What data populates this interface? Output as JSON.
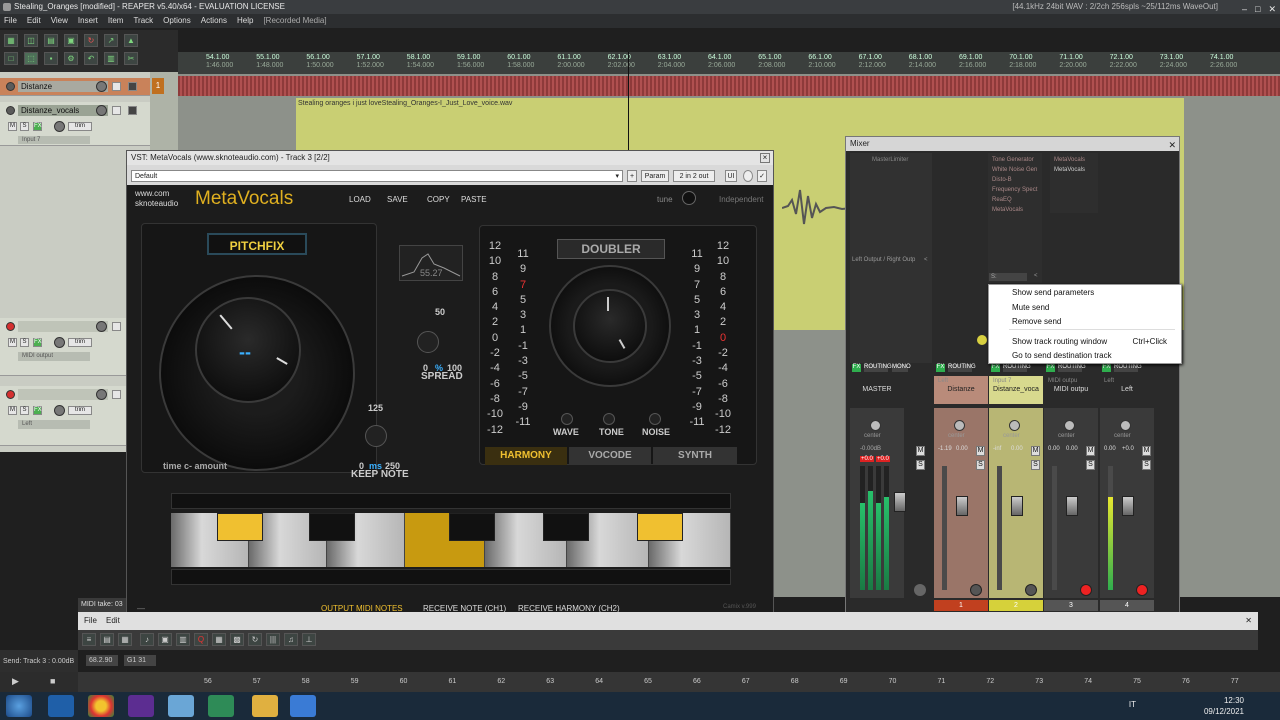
{
  "window": {
    "title": "Stealing_Oranges [modified] - REAPER v5.40/x64 - EVALUATION LICENSE",
    "status": "[44.1kHz 24bit WAV : 2/2ch 256spls ~25/112ms WaveOut]"
  },
  "menu": [
    "File",
    "Edit",
    "View",
    "Insert",
    "Item",
    "Track",
    "Options",
    "Actions",
    "Help"
  ],
  "menu_recorded": "[Recorded Media]",
  "ruler": [
    {
      "bar": "54.1.00",
      "time": "1:46.000"
    },
    {
      "bar": "55.1.00",
      "time": "1:48.000"
    },
    {
      "bar": "56.1.00",
      "time": "1:50.000"
    },
    {
      "bar": "57.1.00",
      "time": "1:52.000"
    },
    {
      "bar": "58.1.00",
      "time": "1:54.000"
    },
    {
      "bar": "59.1.00",
      "time": "1:56.000"
    },
    {
      "bar": "60.1.00",
      "time": "1:58.000"
    },
    {
      "bar": "61.1.00",
      "time": "2:00.000"
    },
    {
      "bar": "62.1.00",
      "time": "2:02.000"
    },
    {
      "bar": "63.1.00",
      "time": "2:04.000"
    },
    {
      "bar": "64.1.00",
      "time": "2:06.000"
    },
    {
      "bar": "65.1.00",
      "time": "2:08.000"
    },
    {
      "bar": "66.1.00",
      "time": "2:10.000"
    },
    {
      "bar": "67.1.00",
      "time": "2:12.000"
    },
    {
      "bar": "68.1.00",
      "time": "2:14.000"
    },
    {
      "bar": "69.1.00",
      "time": "2:16.000"
    },
    {
      "bar": "70.1.00",
      "time": "2:18.000"
    },
    {
      "bar": "71.1.00",
      "time": "2:20.000"
    },
    {
      "bar": "72.1.00",
      "time": "2:22.000"
    },
    {
      "bar": "73.1.00",
      "time": "2:24.000"
    },
    {
      "bar": "74.1.00",
      "time": "2:26.000"
    }
  ],
  "tracks": {
    "t1": {
      "name": "Distanze",
      "number": "1"
    },
    "t2": {
      "name": "Distanze_vocals",
      "input": "Input 7"
    },
    "t3": {
      "input": "MIDI output"
    },
    "t4": {
      "input": "Left"
    }
  },
  "track_buttons": {
    "m": "M",
    "s": "S",
    "fx": "FX",
    "trim": "trim",
    "route": "ROUTE",
    "out": "OUT"
  },
  "item": {
    "label": "Stealing oranges i just loveStealing_Oranges-I_Just_Love_voice.wav"
  },
  "vst": {
    "title": "VST: MetaVocals (www.sknoteaudio.com) - Track 3 [2/2]",
    "preset": "Default",
    "plus": "+",
    "param": "Param",
    "io": "2 in 2 out",
    "ui": "UI",
    "close": "×",
    "plugin": {
      "brand_line1": "www.com",
      "brand_line2": "sknoteaudio",
      "name": "MetaVocals",
      "load": "LOAD",
      "save": "SAVE",
      "copy": "COPY",
      "paste": "PASTE",
      "tune": "tune",
      "independent": "Independent",
      "pitchfix": "PITCHFIX",
      "pitch_display": "--",
      "time_label": "time c- amount",
      "spread_value": "50",
      "spread_min": "0",
      "spread_unit": "%",
      "spread_max": "100",
      "spread": "SPREAD",
      "graph_value": "55.27",
      "keep_value": "125",
      "keep_min": "0",
      "keep_unit": "ms",
      "keep_max": "250",
      "keep_note": "KEEP NOTE",
      "doubler": "DOUBLER",
      "wave": "WAVE",
      "tone": "TONE",
      "noise": "NOISE",
      "harmony": "HARMONY",
      "vocode": "VOCODE",
      "synth": "SYNTH",
      "scale_left": [
        "12",
        "10",
        "8",
        "6",
        "4",
        "2",
        "0",
        "-2",
        "-4",
        "-6",
        "-8",
        "-10",
        "-12"
      ],
      "scale_left_odd": [
        "11",
        "9",
        "7",
        "5",
        "3",
        "1",
        "-1",
        "-3",
        "-5",
        "-7",
        "-9",
        "-11"
      ],
      "scale_right_odd": [
        "11",
        "9",
        "7",
        "5",
        "3",
        "1",
        "-1",
        "-3",
        "-5",
        "-7",
        "-9",
        "-11"
      ],
      "scale_right": [
        "12",
        "10",
        "8",
        "6",
        "4",
        "2",
        "0",
        "-2",
        "-4",
        "-6",
        "-8",
        "-10",
        "-12"
      ],
      "highlight_left": "7",
      "highlight_right": "0",
      "out_midi": "OUTPUT MIDI NOTES",
      "recv_note": "RECEIVE NOTE (CH1)",
      "recv_harm": "RECEIVE HARMONY (CH2)",
      "version": "Camix v.999",
      "dash": "—"
    }
  },
  "mixer": {
    "title": "Mixer",
    "master_fx": [
      "MasterLimiter"
    ],
    "fx_col2": [
      "Tone Generator",
      "White Noise Gen",
      "Disto-B",
      "Frequency Spect",
      "ReaEQ",
      "MetaVocals"
    ],
    "fx_col3": [
      "MetaVocals",
      "MetaVocals"
    ],
    "send_label": "Left Output / Right Outp",
    "send_lr": "<",
    "send_box": "S:",
    "send_arrow": "<",
    "strips": [
      {
        "name": "MASTER",
        "pan": "center",
        "db_left": "-0.00dB",
        "peak1": "+0.0",
        "peak2": "+0.0",
        "num": ""
      },
      {
        "name": "Distanze",
        "pan": "center",
        "io": "Left",
        "db": "-1.19",
        "peak": "0.00",
        "num": "1"
      },
      {
        "name": "Distanze_voca",
        "pan": "center",
        "io": "Input 7",
        "db": "-inf",
        "peak": "0.00",
        "num": "2"
      },
      {
        "name": "MIDI outpu",
        "pan": "center",
        "io": "MIDI outpu",
        "db": "0.00",
        "peak": "0.00",
        "num": "3"
      },
      {
        "name": "Left",
        "pan": "center",
        "io": "Left",
        "db": "0.00",
        "peak": "+0.0",
        "num": "4"
      }
    ],
    "strip_labels": {
      "fx": "FX",
      "routing": "ROUTING",
      "mono": "MONO",
      "m": "M",
      "s": "S",
      "trim": "trim"
    },
    "mtr_scale": [
      "-6",
      "-12",
      "-18",
      "-24",
      "-30",
      "-36",
      "-42",
      "-48",
      "-54",
      "-60"
    ]
  },
  "context_menu": {
    "items": [
      {
        "label": "Show send parameters",
        "shortcut": ""
      },
      {
        "label": "Mute send",
        "shortcut": ""
      },
      {
        "label": "Remove send",
        "shortcut": ""
      },
      {
        "label": "Show track routing window",
        "shortcut": "Ctrl+Click"
      },
      {
        "label": "Go to send destination track",
        "shortcut": ""
      }
    ]
  },
  "midi": {
    "tab": "MIDI take: 03",
    "menu_file": "File",
    "menu_edit": "Edit",
    "status": "Send: Track 3 : 0.00dB",
    "pos": "68.2.90",
    "grid": "G1 31",
    "ruler": [
      "56",
      "57",
      "58",
      "59",
      "60",
      "61",
      "62",
      "63",
      "64",
      "65",
      "66",
      "67",
      "68",
      "69",
      "70",
      "71",
      "72",
      "73",
      "74",
      "75",
      "76",
      "77"
    ]
  },
  "taskbar": {
    "lang": "IT",
    "time": "12:30",
    "date": "09/12/2021"
  }
}
